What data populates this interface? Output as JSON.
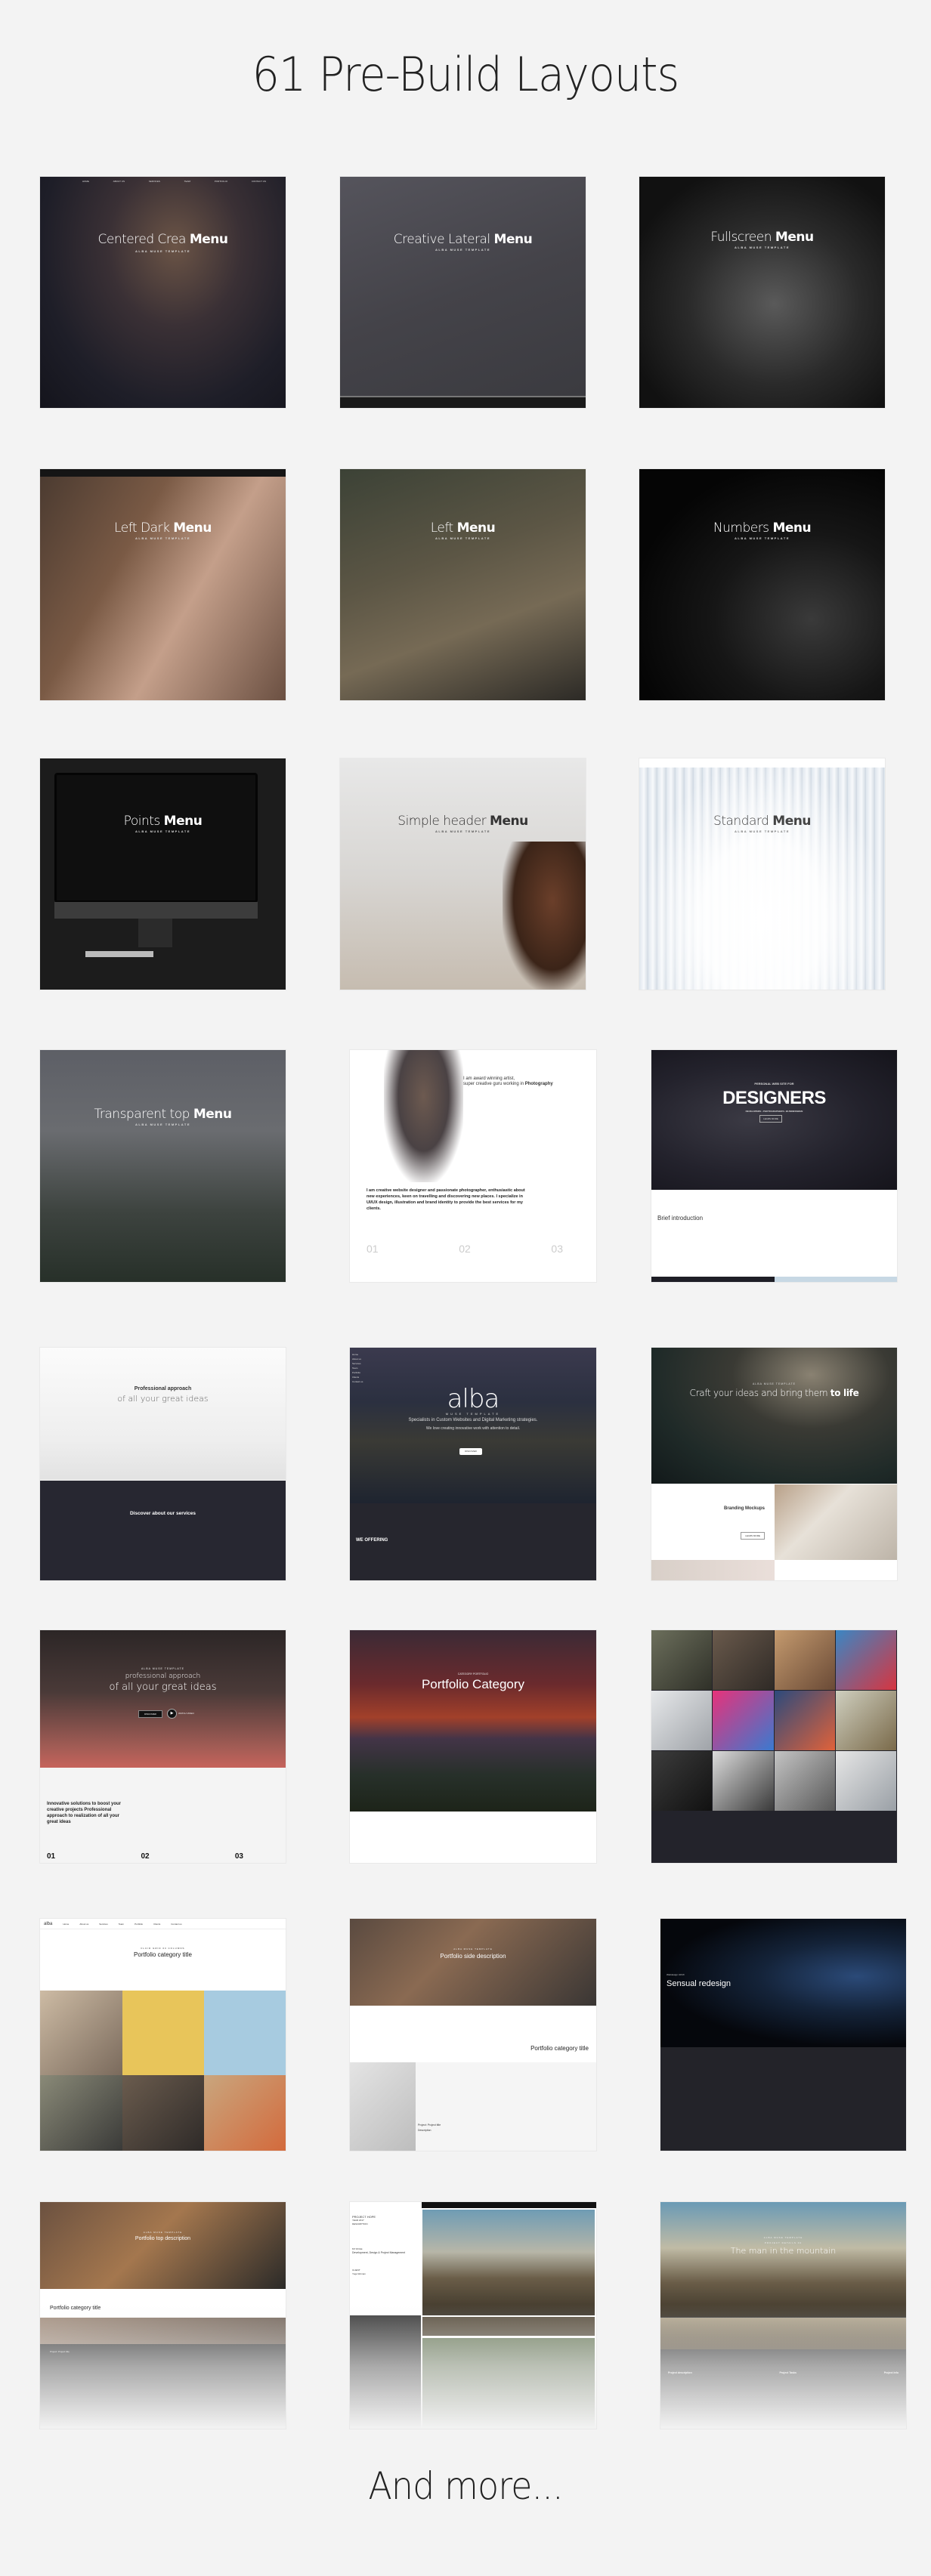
{
  "header": {
    "title": "61 Pre-Build Layouts"
  },
  "footer": {
    "title": "And more..."
  },
  "template_tag": "ALBA MUSE TEMPLATE",
  "layouts": [
    {
      "title_light": "Centered Crea",
      "title_bold": "Menu"
    },
    {
      "title_light": "Creative Lateral",
      "title_bold": "Menu"
    },
    {
      "title_light": "Fullscreen",
      "title_bold": "Menu"
    },
    {
      "title_light": "Left Dark",
      "title_bold": "Menu"
    },
    {
      "title_light": "Left",
      "title_bold": "Menu"
    },
    {
      "title_light": "Numbers",
      "title_bold": "Menu"
    },
    {
      "title_light": "Points",
      "title_bold": "Menu"
    },
    {
      "title_light": "Simple header",
      "title_bold": "Menu"
    },
    {
      "title_light": "Standard",
      "title_bold": "Menu"
    },
    {
      "title_light": "Transparent top",
      "title_bold": "Menu"
    },
    {
      "intro_line1": "I am award winning artist,",
      "intro_line2": "super creative guru working in",
      "intro_bold": "Photography",
      "body": "I am creative website designer and passionate photographer, enthusiastic about new experiences, keen on travelling and discovering new places. I specialize in UI/UX design, illustration and brand identity to provide the best services for my clients.",
      "numbers": [
        "01",
        "02",
        "03"
      ]
    },
    {
      "kicker": "PERSONAL WEB SITE FOR",
      "title": "DESIGNERS",
      "tagline": "DEVELOPERS • PHOTOGRAPHERS • BUSINESSMAN",
      "button": "LEARN MORE",
      "section": "Brief introduction"
    },
    {
      "line1": "Professional approach",
      "line2": "of all your great ideas",
      "section": "Discover about our services"
    },
    {
      "logo": "alba",
      "logo_sub": "MUSE TEMPLATE",
      "line1": "Specialists in Custom Websites and Digital Marketing strategies.",
      "line2": "We love creating innovative work with attention to detail.",
      "button": "DISCOVER",
      "section": "WE OFFERING",
      "menu": [
        "Home",
        "About us",
        "Services",
        "Team",
        "Portfolio",
        "Clients",
        "Contact us"
      ]
    },
    {
      "kicker": "ALBA MUSE TEMPLATE",
      "title_light": "Craft your ideas and bring them",
      "title_bold": "to life",
      "section": "Branding Mockups",
      "button": "LEARN MORE"
    },
    {
      "kicker": "ALBA MUSE TEMPLATE",
      "line1": "professional approach",
      "line2": "of all your great ideas",
      "button": "DISCOVER",
      "video": "WATCH VIDEO",
      "section": "Innovative solutions to boost your creative projects Professional approach to realization of all your great ideas",
      "numbers": [
        "01",
        "02",
        "03"
      ]
    },
    {
      "kicker": "CATEGORY PORTFOLIO",
      "title": "Portfolio Category"
    },
    {
      "type": "grid",
      "tiles": 12
    },
    {
      "kicker": "FLUID GRID 03 COLUMNS",
      "title": "Portfolio category title",
      "menu": [
        "Home",
        "About us",
        "Services",
        "Team",
        "Portfolio",
        "Clients",
        "Contact us"
      ]
    },
    {
      "kicker": "ALBA MUSE TEMPLATE",
      "title": "Portfolio side description",
      "section": "Portfolio category title",
      "project": "Project: Project title",
      "desc": "Description"
    },
    {
      "kicker": "Webdesign UI/UX",
      "title": "Sensual redesign"
    },
    {
      "kicker": "ALBA MUSE TEMPLATE",
      "title": "Portfolio top description",
      "section": "Portfolio category title",
      "project": "Project: Project title"
    },
    {
      "project": "PROJECT HOPE",
      "year": "YEAR 2017",
      "desc_label": "DESCRIPTION",
      "role_label": "MY ROLE",
      "role": "Development, Design & Project Management",
      "client_label": "CLIENT",
      "client": "Yoga Woman"
    },
    {
      "kicker": "ALBA MUSE TEMPLATE",
      "kicker2": "PROJECT DETAILS 02",
      "title": "The man in the mountain",
      "cols": [
        "Project description",
        "Project Tasks",
        "Project Info"
      ]
    }
  ]
}
